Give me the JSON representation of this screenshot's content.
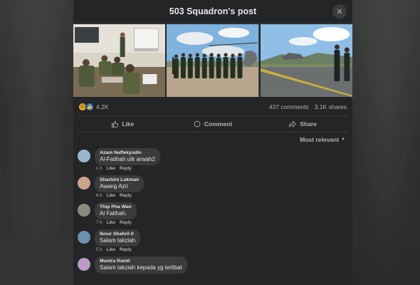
{
  "header": {
    "title": "503 Squadron's post",
    "close_icon": "close-icon"
  },
  "photos": [
    {
      "name": "classroom-briefing"
    },
    {
      "name": "group-helicopter"
    },
    {
      "name": "airfield-crew"
    }
  ],
  "stats": {
    "reaction_count": "4.2K",
    "comments": "437 comments",
    "shares": "3.1K shares"
  },
  "actions": {
    "like": "Like",
    "comment": "Comment",
    "share": "Share"
  },
  "sort": {
    "label": "Most relevant"
  },
  "comments": [
    {
      "name": "Azam Naffekyudin",
      "text": "Al-Fatihah utk arwah2",
      "time": "1 h",
      "like": "Like",
      "reply": "Reply",
      "avatar_color": "#9bb6c8"
    },
    {
      "name": "Sharbini Lukman",
      "text": "Awang Azri",
      "time": "6 h",
      "like": "Like",
      "reply": "Reply",
      "avatar_color": "#c9a58b"
    },
    {
      "name": "Thip Pha Wan",
      "text": "Al Fatihah.",
      "time": "7 h",
      "like": "Like",
      "reply": "Reply",
      "avatar_color": "#8c8a7a"
    },
    {
      "name": "Ibnur Shahril Il",
      "text": "Salam takziah",
      "time": "5 h",
      "like": "Like",
      "reply": "Reply",
      "avatar_color": "#6d8fb0"
    },
    {
      "name": "Munira Ramli",
      "text": "Salam takziah kepada yg terlibat",
      "time": "",
      "like": "",
      "reply": "",
      "avatar_color": "#b99bc4"
    }
  ]
}
